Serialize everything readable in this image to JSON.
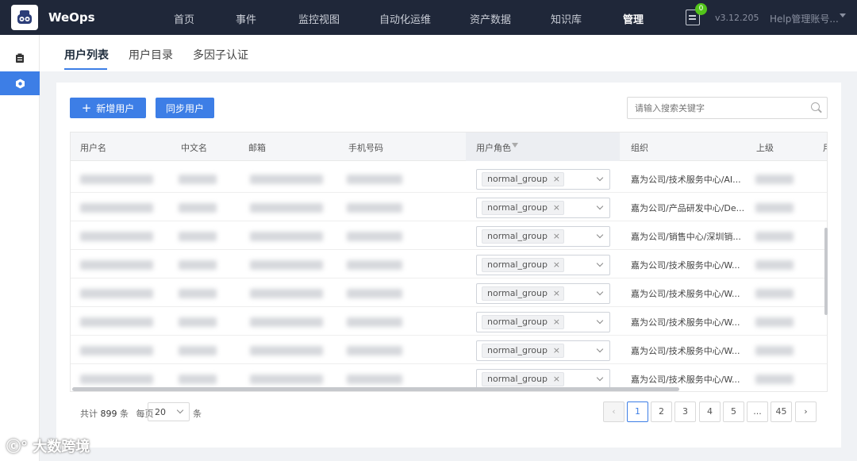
{
  "header": {
    "brand": "WeOps",
    "nav": [
      "首页",
      "事件",
      "监控视图",
      "自动化运维",
      "资产数据",
      "知识库",
      "管理"
    ],
    "active_nav": "管理",
    "notification_count": "0",
    "version": "v3.12.205",
    "account": "Help管理账号..."
  },
  "tabs": [
    "用户列表",
    "用户目录",
    "多因子认证"
  ],
  "toolbar": {
    "add_user": "新增用户",
    "sync_user": "同步用户",
    "search_placeholder": "请输入搜索关键字"
  },
  "table": {
    "columns": [
      "用户名",
      "中文名",
      "邮箱",
      "手机号码",
      "用户角色",
      "组织",
      "上级",
      "用"
    ],
    "rows": [
      {
        "role": "normal_group",
        "org": "嘉为公司/技术服务中心/AI..."
      },
      {
        "role": "normal_group",
        "org": "嘉为公司/产品研发中心/De..."
      },
      {
        "role": "normal_group",
        "org": "嘉为公司/销售中心/深圳销..."
      },
      {
        "role": "normal_group",
        "org": "嘉为公司/技术服务中心/W..."
      },
      {
        "role": "normal_group",
        "org": "嘉为公司/技术服务中心/W..."
      },
      {
        "role": "normal_group",
        "org": "嘉为公司/技术服务中心/W..."
      },
      {
        "role": "normal_group",
        "org": "嘉为公司/技术服务中心/W..."
      },
      {
        "role": "normal_group",
        "org": "嘉为公司/技术服务中心/W..."
      }
    ]
  },
  "pagination": {
    "total_prefix": "共计",
    "total": "899",
    "total_suffix": "条",
    "per_page_label": "每页",
    "page_size": "20",
    "page_size_unit": "条",
    "pages": [
      "1",
      "2",
      "3",
      "4",
      "5",
      "...",
      "45"
    ],
    "current_page": "1"
  },
  "watermark": "大数跨境",
  "colors": {
    "primary": "#3d7ee6",
    "topbar": "#1f2739",
    "badge": "#52c41a"
  }
}
